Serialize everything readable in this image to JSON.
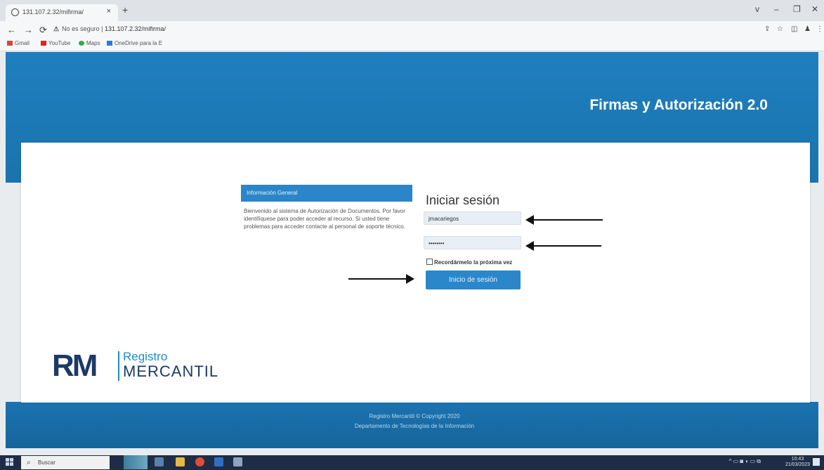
{
  "browser": {
    "tab_title": "131.107.2.32/mifirma/",
    "tab_close": "×",
    "new_tab": "+",
    "window_controls": [
      "v",
      "–",
      "❐",
      "✕"
    ],
    "security_label": "No es seguro",
    "url": "131.107.2.32/mifirma/",
    "bookmarks": [
      "Gmail",
      "YouTube",
      "Maps",
      "OneDrive para la E"
    ]
  },
  "page": {
    "app_title": "Firmas y Autorización 2.0",
    "info_panel": {
      "header": "Información General",
      "body": "Bienvenido al sistema de Autorización de Documentos. Por favor identifíquese para poder acceder al recurso. Si usted tiene problemas para acceder contacte al personal de soporte técnico."
    },
    "login": {
      "title": "Iniciar sesión",
      "username_value": "jmacariegos",
      "password_value": "••••••••",
      "remember_label": "Recordármelo la próxima vez",
      "remember_checked": false,
      "submit_label": "Inicio de sesión"
    },
    "logo": {
      "initials": "RM",
      "line1": "Registro",
      "line2": "MERCANTIL"
    },
    "footer": {
      "line1": "Registro Mercantil © Copyright 2020",
      "line2": "Departamento de Tecnologías de la Información"
    }
  },
  "taskbar": {
    "search_placeholder": "Buscar",
    "clock_time": "10:43",
    "clock_date": "21/03/2023"
  },
  "colors": {
    "header_blue": "#1f7fbf",
    "button_blue": "#2b87c9",
    "logo_navy": "#1d3a66",
    "logo_accent": "#1e8ad0"
  }
}
